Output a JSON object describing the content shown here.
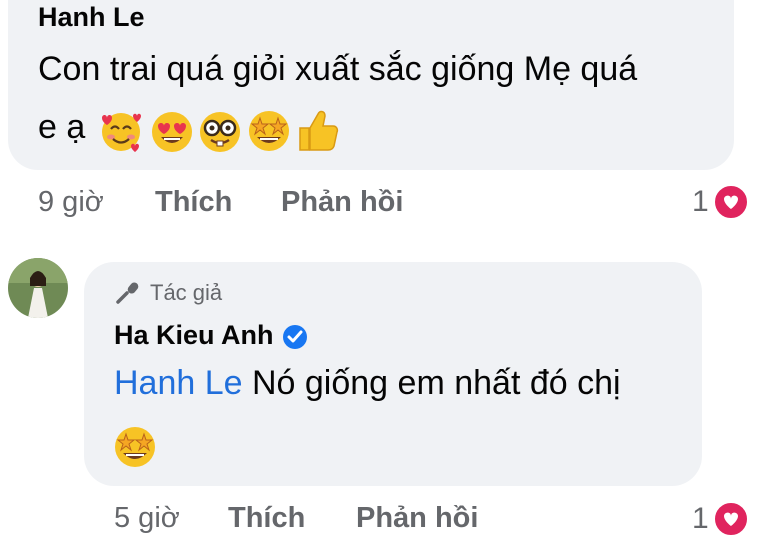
{
  "comment1": {
    "author": "Hanh Le",
    "text_line1": "Con trai quá giỏi xuất sắc giống Mẹ quá",
    "text_line2": "e ạ",
    "emojis": [
      "smiling-face-with-hearts",
      "heart-eyes",
      "nerd-face",
      "star-struck",
      "thumbs-up"
    ],
    "time": "9 giờ",
    "like_label": "Thích",
    "reply_label": "Phản hồi",
    "reaction_count": "1"
  },
  "comment2": {
    "badge": "Tác giả",
    "author": "Ha Kieu Anh",
    "mention": "Hanh Le",
    "text": " Nó giống em nhất đó chị",
    "emojis": [
      "star-struck"
    ],
    "time": "5 giờ",
    "like_label": "Thích",
    "reply_label": "Phản hồi",
    "reaction_count": "1"
  },
  "colors": {
    "bubble": "#f0f2f5",
    "mention": "#216fdb",
    "heart_reaction": "#e0245e",
    "verified": "#1877f2",
    "muted": "#65676b"
  }
}
